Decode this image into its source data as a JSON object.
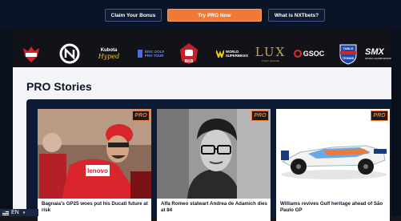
{
  "nav": {
    "claim_bonus": "Claim Your Bonus",
    "try_pro": "Try PRO Now",
    "what_is_nxtbets": "What is NXTbets?"
  },
  "logos": {
    "kubota_line1": "Kubota",
    "kubota_line2": "Hyped",
    "disc_golf_line1": "DISC GOLF",
    "disc_golf_line2": "PRO TOUR",
    "bkb": "BKB",
    "world_superbikes_line1": "WORLD",
    "world_superbikes_line2": "SUPERBIKES",
    "lux": "LUX",
    "lux_sub": "FIGHT LEAGUE",
    "gsoc": "GSOC",
    "table_tennis_line1": "TABLE",
    "table_tennis_line2": "TENNIS",
    "smx": "SMX",
    "smx_sub": "WORLD CHAMPIONSHIP"
  },
  "section": {
    "title": "PRO Stories"
  },
  "stories": [
    {
      "badge": "PRO",
      "title": "Bagnaia's GP25 woes put his Ducati future at risk"
    },
    {
      "badge": "PRO",
      "title": "Alfa Romeo stalwart Andrea de Adamich dies at 84"
    },
    {
      "badge": "PRO",
      "title": "Williams revives Gulf heritage ahead of São Paulo GP"
    }
  ],
  "language": {
    "code": "EN"
  },
  "colors": {
    "accent": "#f07a35",
    "navy": "#0c1a33",
    "background": "#16171c"
  }
}
